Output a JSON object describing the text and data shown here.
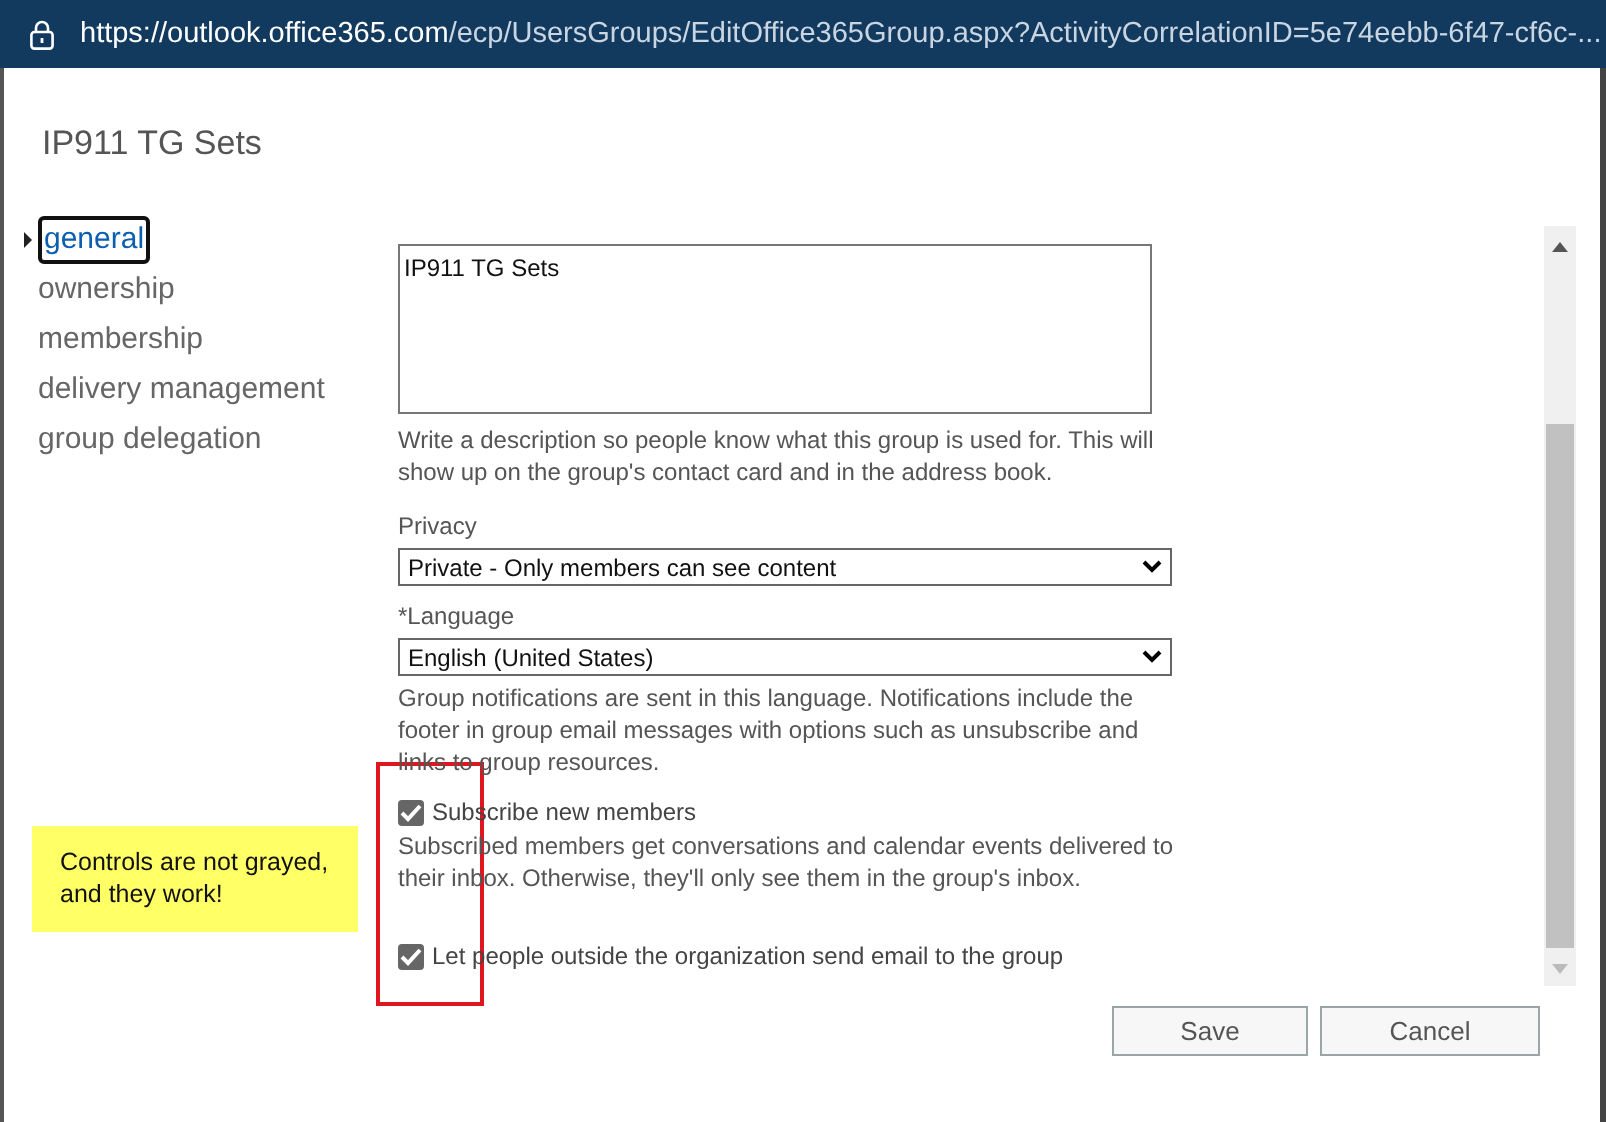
{
  "address_bar": {
    "host": "https://outlook.office365.com",
    "path": "/ecp/UsersGroups/EditOffice365Group.aspx?ActivityCorrelationID=5e74eebb-6f47-cf6c-..."
  },
  "title": "IP911 TG Sets",
  "nav": [
    {
      "label": "general",
      "selected": true
    },
    {
      "label": "ownership",
      "selected": false
    },
    {
      "label": "membership",
      "selected": false
    },
    {
      "label": "delivery management",
      "selected": false
    },
    {
      "label": "group delegation",
      "selected": false
    }
  ],
  "description": {
    "value": "IP911 TG Sets",
    "help": "Write a description so people know what this group is used for. This will show up on the group's contact card and in the address book."
  },
  "privacy": {
    "label": "Privacy",
    "value": "Private - Only members can see content"
  },
  "language": {
    "label": "*Language",
    "value": "English (United States)",
    "help": "Group notifications are sent in this language. Notifications include the footer in group email messages with options such as unsubscribe and links to group resources."
  },
  "options": [
    {
      "label": "Subscribe new members",
      "checked": true,
      "help": "Subscribed members get conversations and calendar events delivered to their inbox. Otherwise, they'll only see them in the group's inbox."
    },
    {
      "label": "Let people outside the organization send email to the group",
      "checked": true
    }
  ],
  "buttons": [
    "Save",
    "Cancel"
  ],
  "annotation": {
    "note": "Controls are not grayed, and they work!"
  }
}
